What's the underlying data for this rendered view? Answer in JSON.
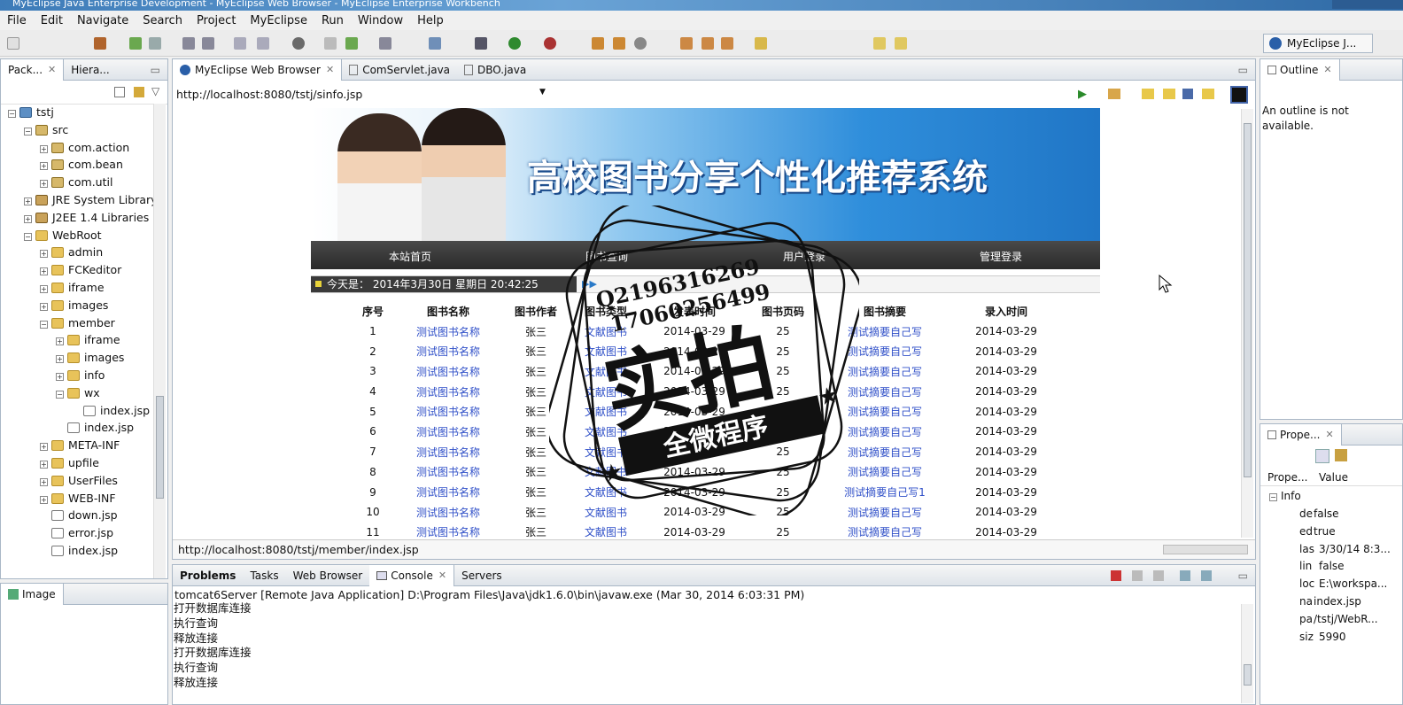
{
  "window": {
    "title": "MyEclipse Java Enterprise Development - MyEclipse Web Browser - MyEclipse Enterprise Workbench"
  },
  "menu": [
    "File",
    "Edit",
    "Navigate",
    "Search",
    "Project",
    "MyEclipse",
    "Run",
    "Window",
    "Help"
  ],
  "perspective": {
    "label": "MyEclipse J..."
  },
  "left_view": {
    "tabs": [
      "Pack...",
      "Hiera..."
    ],
    "tree": [
      {
        "label": "tstj",
        "depth": 0,
        "icon": "project-icon"
      },
      {
        "label": "src",
        "depth": 1,
        "icon": "source-folder-icon"
      },
      {
        "label": "com.action",
        "depth": 2,
        "icon": "package-icon"
      },
      {
        "label": "com.bean",
        "depth": 2,
        "icon": "package-icon"
      },
      {
        "label": "com.util",
        "depth": 2,
        "icon": "package-icon"
      },
      {
        "label": "JRE System Library",
        "depth": 1,
        "icon": "library-icon"
      },
      {
        "label": "J2EE 1.4 Libraries",
        "depth": 1,
        "icon": "library-icon"
      },
      {
        "label": "WebRoot",
        "depth": 1,
        "icon": "folder-icon"
      },
      {
        "label": "admin",
        "depth": 2,
        "icon": "folder-icon"
      },
      {
        "label": "FCKeditor",
        "depth": 2,
        "icon": "folder-icon"
      },
      {
        "label": "iframe",
        "depth": 2,
        "icon": "folder-icon"
      },
      {
        "label": "images",
        "depth": 2,
        "icon": "folder-icon"
      },
      {
        "label": "member",
        "depth": 2,
        "icon": "folder-icon"
      },
      {
        "label": "iframe",
        "depth": 3,
        "icon": "folder-icon"
      },
      {
        "label": "images",
        "depth": 3,
        "icon": "folder-icon"
      },
      {
        "label": "info",
        "depth": 3,
        "icon": "folder-icon"
      },
      {
        "label": "wx",
        "depth": 3,
        "icon": "folder-icon"
      },
      {
        "label": "index.jsp",
        "depth": 4,
        "icon": "jsp-file-icon"
      },
      {
        "label": "index.jsp",
        "depth": 3,
        "icon": "jsp-file-icon"
      },
      {
        "label": "META-INF",
        "depth": 2,
        "icon": "folder-icon"
      },
      {
        "label": "upfile",
        "depth": 2,
        "icon": "folder-icon"
      },
      {
        "label": "UserFiles",
        "depth": 2,
        "icon": "folder-icon"
      },
      {
        "label": "WEB-INF",
        "depth": 2,
        "icon": "folder-icon"
      },
      {
        "label": "down.jsp",
        "depth": 2,
        "icon": "jsp-file-icon"
      },
      {
        "label": "error.jsp",
        "depth": 2,
        "icon": "jsp-file-icon"
      },
      {
        "label": "index.jsp",
        "depth": 2,
        "icon": "jsp-file-icon"
      }
    ]
  },
  "bottom_left_view": {
    "tab": "Image"
  },
  "editor": {
    "tabs": [
      "MyEclipse Web Browser",
      "ComServlet.java",
      "DBO.java"
    ],
    "url": "http://localhost:8080/tstj/sinfo.jsp",
    "status_url": "http://localhost:8080/tstj/member/index.jsp"
  },
  "site": {
    "title": "高校图书分享个性化推荐系统",
    "nav": [
      "本站首页",
      "图书查询",
      "用户登录",
      "管理登录"
    ],
    "date": "今天是： 2014年3月30日 星期日 20:42:25",
    "columns": [
      "序号",
      "图书名称",
      "图书作者",
      "图书类型",
      "发表时间",
      "图书页码",
      "图书摘要",
      "录入时间"
    ],
    "rows": [
      [
        "1",
        "测试图书名称",
        "张三",
        "文献图书",
        "2014-03-29",
        "25",
        "测试摘要自己写",
        "2014-03-29"
      ],
      [
        "2",
        "测试图书名称",
        "张三",
        "文献图书",
        "2014-03-29",
        "25",
        "测试摘要自己写",
        "2014-03-29"
      ],
      [
        "3",
        "测试图书名称",
        "张三",
        "文献图书",
        "2014-03-29",
        "25",
        "测试摘要自己写",
        "2014-03-29"
      ],
      [
        "4",
        "测试图书名称",
        "张三",
        "文献图书",
        "2014-03-29",
        "25",
        "测试摘要自己写",
        "2014-03-29"
      ],
      [
        "5",
        "测试图书名称",
        "张三",
        "文献图书",
        "2014-03-29",
        "25",
        "测试摘要自己写",
        "2014-03-29"
      ],
      [
        "6",
        "测试图书名称",
        "张三",
        "文献图书",
        "2014-03-29",
        "25",
        "测试摘要自己写",
        "2014-03-29"
      ],
      [
        "7",
        "测试图书名称",
        "张三",
        "文献图书",
        "2014-03-29",
        "25",
        "测试摘要自己写",
        "2014-03-29"
      ],
      [
        "8",
        "测试图书名称",
        "张三",
        "文献图书",
        "2014-03-29",
        "25",
        "测试摘要自己写",
        "2014-03-29"
      ],
      [
        "9",
        "测试图书名称",
        "张三",
        "文献图书",
        "2014-03-29",
        "25",
        "测试摘要自己写1",
        "2014-03-29"
      ],
      [
        "10",
        "测试图书名称",
        "张三",
        "文献图书",
        "2014-03-29",
        "25",
        "测试摘要自己写",
        "2014-03-29"
      ],
      [
        "11",
        "测试图书名称",
        "张三",
        "文献图书",
        "2014-03-29",
        "25",
        "测试摘要自己写",
        "2014-03-29"
      ]
    ]
  },
  "watermark": {
    "line1": "Q2196316269",
    "line2": "17060256499",
    "big": "实拍",
    "ribbon": "全微程序"
  },
  "bottom_view": {
    "tabs": [
      "Problems",
      "Tasks",
      "Web Browser",
      "Console",
      "Servers"
    ],
    "header": "tomcat6Server [Remote Java Application] D:\\Program Files\\Java\\jdk1.6.0\\bin\\javaw.exe (Mar 30, 2014 6:03:31 PM)",
    "lines": [
      "打开数据库连接",
      "执行查询",
      "释放连接",
      "打开数据库连接",
      "执行查询",
      "释放连接"
    ]
  },
  "outline": {
    "tab": "Outline",
    "message": "An outline is not available."
  },
  "properties": {
    "tab": "Prope...",
    "col1": "Prope...",
    "col2": "Value",
    "group": "Info",
    "rows": [
      [
        "de",
        "false"
      ],
      [
        "ed",
        "true"
      ],
      [
        "las",
        "3/30/14 8:3..."
      ],
      [
        "lin",
        "false"
      ],
      [
        "loc",
        "E:\\workspa..."
      ],
      [
        "na",
        "index.jsp"
      ],
      [
        "pa",
        "/tstj/WebR..."
      ],
      [
        "siz",
        "5990"
      ]
    ]
  }
}
